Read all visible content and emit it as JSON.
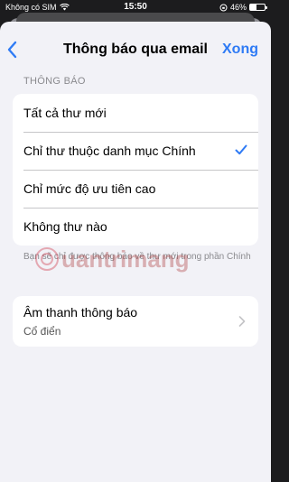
{
  "status_bar": {
    "carrier": "Không có SIM",
    "time": "15:50",
    "battery_percent": "46%",
    "battery_level": 0.46
  },
  "nav": {
    "title": "Thông báo qua email",
    "done_label": "Xong"
  },
  "notifications": {
    "header": "THÔNG BÁO",
    "options": [
      {
        "label": "Tất cả thư mới",
        "selected": false
      },
      {
        "label": "Chỉ thư thuộc danh mục Chính",
        "selected": true
      },
      {
        "label": "Chỉ mức độ ưu tiên cao",
        "selected": false
      },
      {
        "label": "Không thư nào",
        "selected": false
      }
    ],
    "footer": "Bạn sẽ chỉ được thông báo về thư mới trong phần Chính"
  },
  "sound": {
    "title": "Âm thanh thông báo",
    "value": "Cổ điển"
  },
  "colors": {
    "accent": "#2f7bf5",
    "background": "#f2f2f7",
    "card": "#ffffff"
  },
  "icons": [
    "wifi-icon",
    "lock-rotation-icon",
    "battery-icon",
    "back-chevron-icon",
    "checkmark-icon",
    "chevron-right-icon"
  ]
}
